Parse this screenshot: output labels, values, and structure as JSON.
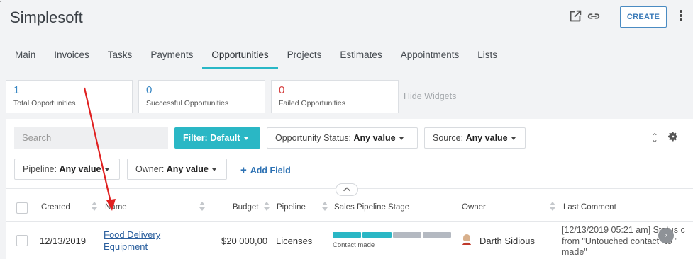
{
  "app": {
    "title": "Simplesoft",
    "create_label": "CREATE",
    "icons": [
      "open-external-icon",
      "link-icon",
      "more-vert-icon"
    ]
  },
  "tabs": [
    {
      "label": "Main",
      "active": false
    },
    {
      "label": "Invoices",
      "active": false
    },
    {
      "label": "Tasks",
      "active": false
    },
    {
      "label": "Payments",
      "active": false
    },
    {
      "label": "Opportunities",
      "active": true
    },
    {
      "label": "Projects",
      "active": false
    },
    {
      "label": "Estimates",
      "active": false
    },
    {
      "label": "Appointments",
      "active": false
    },
    {
      "label": "Lists",
      "active": false
    }
  ],
  "widgets": {
    "total": {
      "value": "1",
      "label": "Total Opportunities"
    },
    "successful": {
      "value": "0",
      "label": "Successful Opportunities"
    },
    "failed": {
      "value": "0",
      "label": "Failed Opportunities"
    },
    "hide_label": "Hide Widgets"
  },
  "filters": {
    "search_placeholder": "Search",
    "filter_button": "Filter: Default",
    "status": {
      "label": "Opportunity Status:",
      "value": "Any value"
    },
    "source": {
      "label": "Source:",
      "value": "Any value"
    },
    "pipeline": {
      "label": "Pipeline:",
      "value": "Any value"
    },
    "owner": {
      "label": "Owner:",
      "value": "Any value"
    },
    "add_field": "Add Field"
  },
  "table": {
    "columns": [
      "Created",
      "Name",
      "Budget",
      "Pipeline",
      "Sales Pipeline Stage",
      "Owner",
      "Last Comment"
    ],
    "rows": [
      {
        "created": "12/13/2019",
        "name_line1": "Food Delivery",
        "name_line2": "Equipment",
        "budget": "$20 000,00",
        "pipeline": "Licenses",
        "stage_label": "Contact made",
        "stage_segments": [
          "#2ab7c5",
          "#2ab7c5",
          "#b4b9c1",
          "#b4b9c1"
        ],
        "owner": "Darth Sidious",
        "comment_line1": "[12/13/2019 05:21 am] Status c",
        "comment_line2": "from \"Untouched contact\" to \"",
        "comment_line3": "made\""
      }
    ]
  },
  "colors": {
    "accent": "#2ab7c5",
    "link": "#2a5f9e",
    "failed": "#d43a3a",
    "annotation_arrow": "#e02020"
  }
}
